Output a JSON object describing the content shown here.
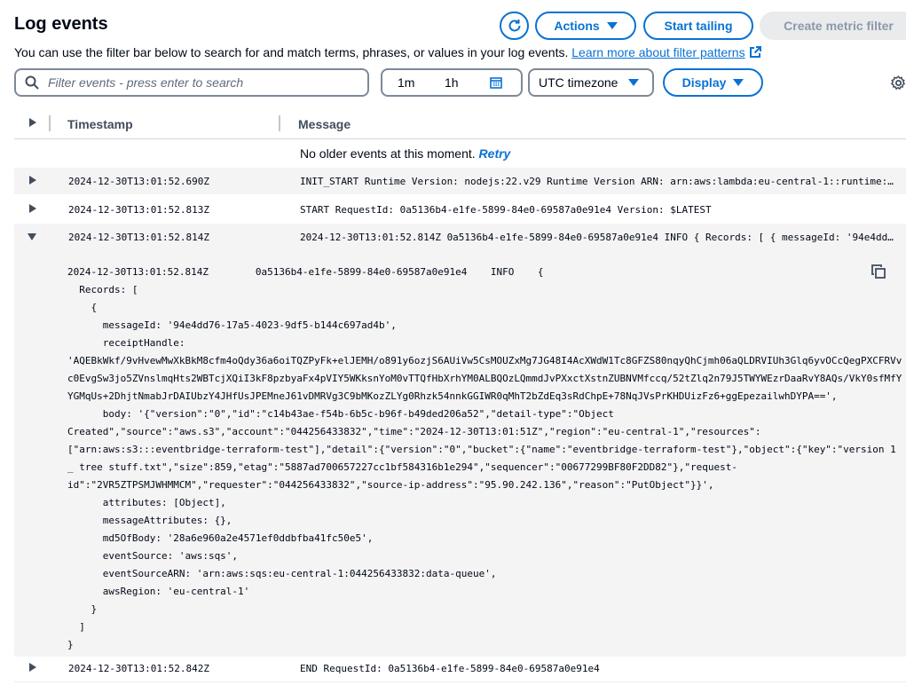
{
  "header": {
    "title": "Log events",
    "subtitle": "You can use the filter bar below to search for and match terms, phrases, or values in your log events.",
    "learn_more": "Learn more about filter patterns",
    "actions_label": "Actions",
    "start_tailing_label": "Start tailing",
    "create_metric_filter_label": "Create metric filter"
  },
  "filters": {
    "search_placeholder": "Filter events - press enter to search",
    "range_1m": "1m",
    "range_1h": "1h",
    "timezone": "UTC timezone",
    "display_label": "Display"
  },
  "table": {
    "col_timestamp": "Timestamp",
    "col_message": "Message",
    "no_older": "No older events at this moment.",
    "retry": "Retry",
    "rows": [
      {
        "timestamp": "2024-12-30T13:01:52.690Z",
        "message": "INIT_START Runtime Version: nodejs:22.v29 Runtime Version ARN: arn:aws:lambda:eu-central-1::runtime:..."
      },
      {
        "timestamp": "2024-12-30T13:01:52.813Z",
        "message": "START RequestId: 0a5136b4-e1fe-5899-84e0-69587a0e91e4 Version: $LATEST"
      },
      {
        "timestamp": "2024-12-30T13:01:52.814Z",
        "message": "2024-12-30T13:01:52.814Z 0a5136b4-e1fe-5899-84e0-69587a0e91e4 INFO { Records: [ { messageId: '94e4dd..."
      },
      {
        "timestamp": "2024-12-30T13:01:52.842Z",
        "message": "END RequestId: 0a5136b4-e1fe-5899-84e0-69587a0e91e4"
      }
    ],
    "expanded_detail": "2024-12-30T13:01:52.814Z\t0a5136b4-e1fe-5899-84e0-69587a0e91e4\tINFO\t{\n  Records: [\n    {\n      messageId: '94e4dd76-17a5-4023-9df5-b144c697ad4b',\n      receiptHandle:\n'AQEBkWkf/9vHvewMwXkBkM8cfm4oQdy36a6oiTQZPyFk+elJEMH/o891y6ozjS6AUiVw5CsMOUZxMg7JG48I4AcXWdW1Tc8GFZS80nqyQhCjmh06aQLDRVIUh3Glq6yvOCcQegPXCFRVv\nc0EvgSw3jo5ZVnslmqHts2WBTcjXQiI3kF8pzbyaFx4pVIY5WKksnYoM0vTTQfHbXrhYM0ALBQOzLQmmdJvPXxctXstnZUBNVMfccq/52tZlq2n79J5TWYWEzrDaaRvY8AQs/VkY0sfMfY\nYGMqUs+2DhjtNmabJrDAIUbzY4JHfUsJPEMneJ61vDMRVg3C9bMKozZLYg0Rhzk54nnkGGIWR0qMhT2bZdEq3sRdChpE+78NqJVsPrKHDUizFz6+ggEpezailwhDYPA==',\n      body: '{\"version\":\"0\",\"id\":\"c14b43ae-f54b-6b5c-b96f-b49ded206a52\",\"detail-type\":\"Object\nCreated\",\"source\":\"aws.s3\",\"account\":\"044256433832\",\"time\":\"2024-12-30T13:01:51Z\",\"region\":\"eu-central-1\",\"resources\":\n[\"arn:aws:s3:::eventbridge-terraform-test\"],\"detail\":{\"version\":\"0\",\"bucket\":{\"name\":\"eventbridge-terraform-test\"},\"object\":{\"key\":\"version 1\n_ tree stuff.txt\",\"size\":859,\"etag\":\"5887ad700657227cc1bf584316b1e294\",\"sequencer\":\"00677299BF80F2DD82\"},\"request-\nid\":\"2VR5ZTPSMJWHMMCM\",\"requester\":\"044256433832\",\"source-ip-address\":\"95.90.242.136\",\"reason\":\"PutObject\"}}',\n      attributes: [Object],\n      messageAttributes: {},\n      md5OfBody: '28a6e960a2e4571ef0ddbfba41fc50e5',\n      eventSource: 'aws:sqs',\n      eventSourceARN: 'arn:aws:sqs:eu-central-1:044256433832:data-queue',\n      awsRegion: 'eu-central-1'\n    }\n  ]\n}"
  },
  "icons": {
    "refresh": "refresh-icon",
    "search": "search-icon",
    "calendar": "calendar-icon",
    "settings": "gear-icon",
    "copy": "copy-icon",
    "external": "external-link-icon"
  },
  "colors": {
    "primary": "#0972d3",
    "text": "#000716",
    "muted": "#5f6b7a",
    "disabled_bg": "#e9ebed",
    "disabled_text": "#8d99a8",
    "row_stripe": "#f4f4f4"
  }
}
